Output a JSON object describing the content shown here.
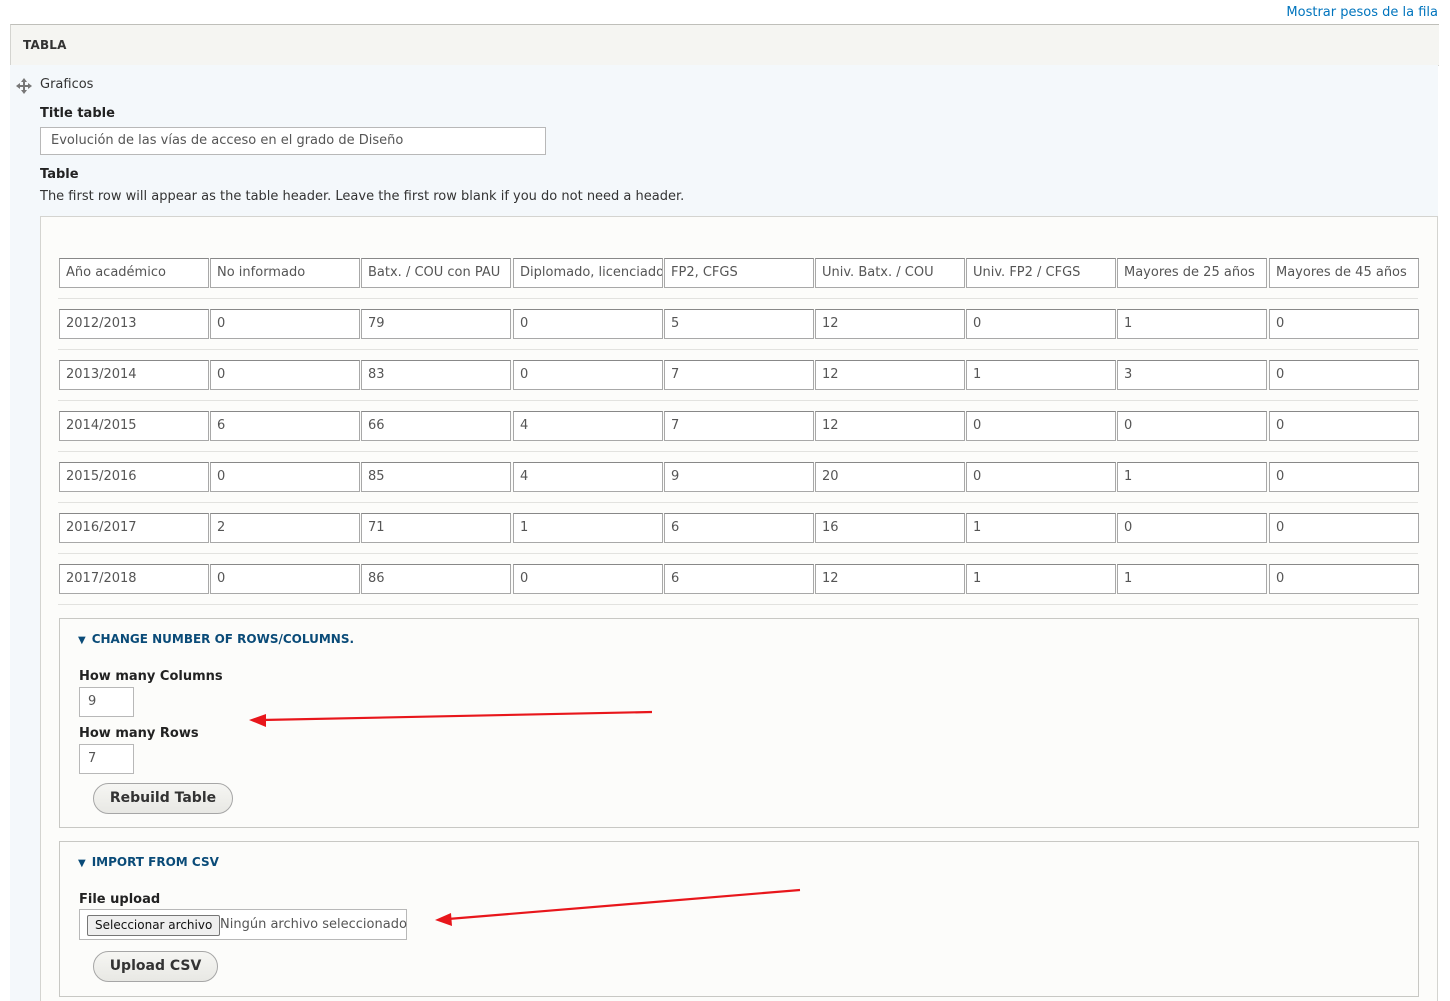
{
  "top_link": "Mostrar pesos de la fila",
  "section_title": "TABLA",
  "drag_item_label": "Graficos",
  "title_table": {
    "label": "Title table",
    "value": "Evolución de las vías de acceso en el grado de Diseño"
  },
  "table": {
    "label": "Table",
    "description": "The first row will appear as the table header. Leave the first row blank if you do not need a header.",
    "header": [
      "Año académico",
      "No informado",
      "Batx. / COU con PAU",
      "Diplomado, licenciado",
      "FP2, CFGS",
      "Univ. Batx. / COU",
      "Univ. FP2 / CFGS",
      "Mayores de 25 años",
      "Mayores de 45 años"
    ],
    "rows": [
      [
        "2012/2013",
        "0",
        "79",
        "0",
        "5",
        "12",
        "0",
        "1",
        "0"
      ],
      [
        "2013/2014",
        "0",
        "83",
        "0",
        "7",
        "12",
        "1",
        "3",
        "0"
      ],
      [
        "2014/2015",
        "6",
        "66",
        "4",
        "7",
        "12",
        "0",
        "0",
        "0"
      ],
      [
        "2015/2016",
        "0",
        "85",
        "4",
        "9",
        "20",
        "0",
        "1",
        "0"
      ],
      [
        "2016/2017",
        "2",
        "71",
        "1",
        "6",
        "16",
        "1",
        "0",
        "0"
      ],
      [
        "2017/2018",
        "0",
        "86",
        "0",
        "6",
        "12",
        "1",
        "1",
        "0"
      ]
    ]
  },
  "change_rows_cols": {
    "legend": "CHANGE NUMBER OF ROWS/COLUMNS.",
    "columns_label": "How many Columns",
    "columns_value": "9",
    "rows_label": "How many Rows",
    "rows_value": "7",
    "rebuild_button": "Rebuild Table"
  },
  "import_csv": {
    "legend": "IMPORT FROM CSV",
    "file_label": "File upload",
    "choose_button": "Seleccionar archivo",
    "file_status": "Ningún archivo seleccionado",
    "upload_button": "Upload CSV"
  },
  "colors": {
    "link": "#0074bd",
    "legend": "#0a4b78",
    "annotation_arrow": "#e8161b"
  },
  "icons": {
    "drag_handle": "move-arrows-icon",
    "collapse_toggle": "triangle-down-icon"
  }
}
